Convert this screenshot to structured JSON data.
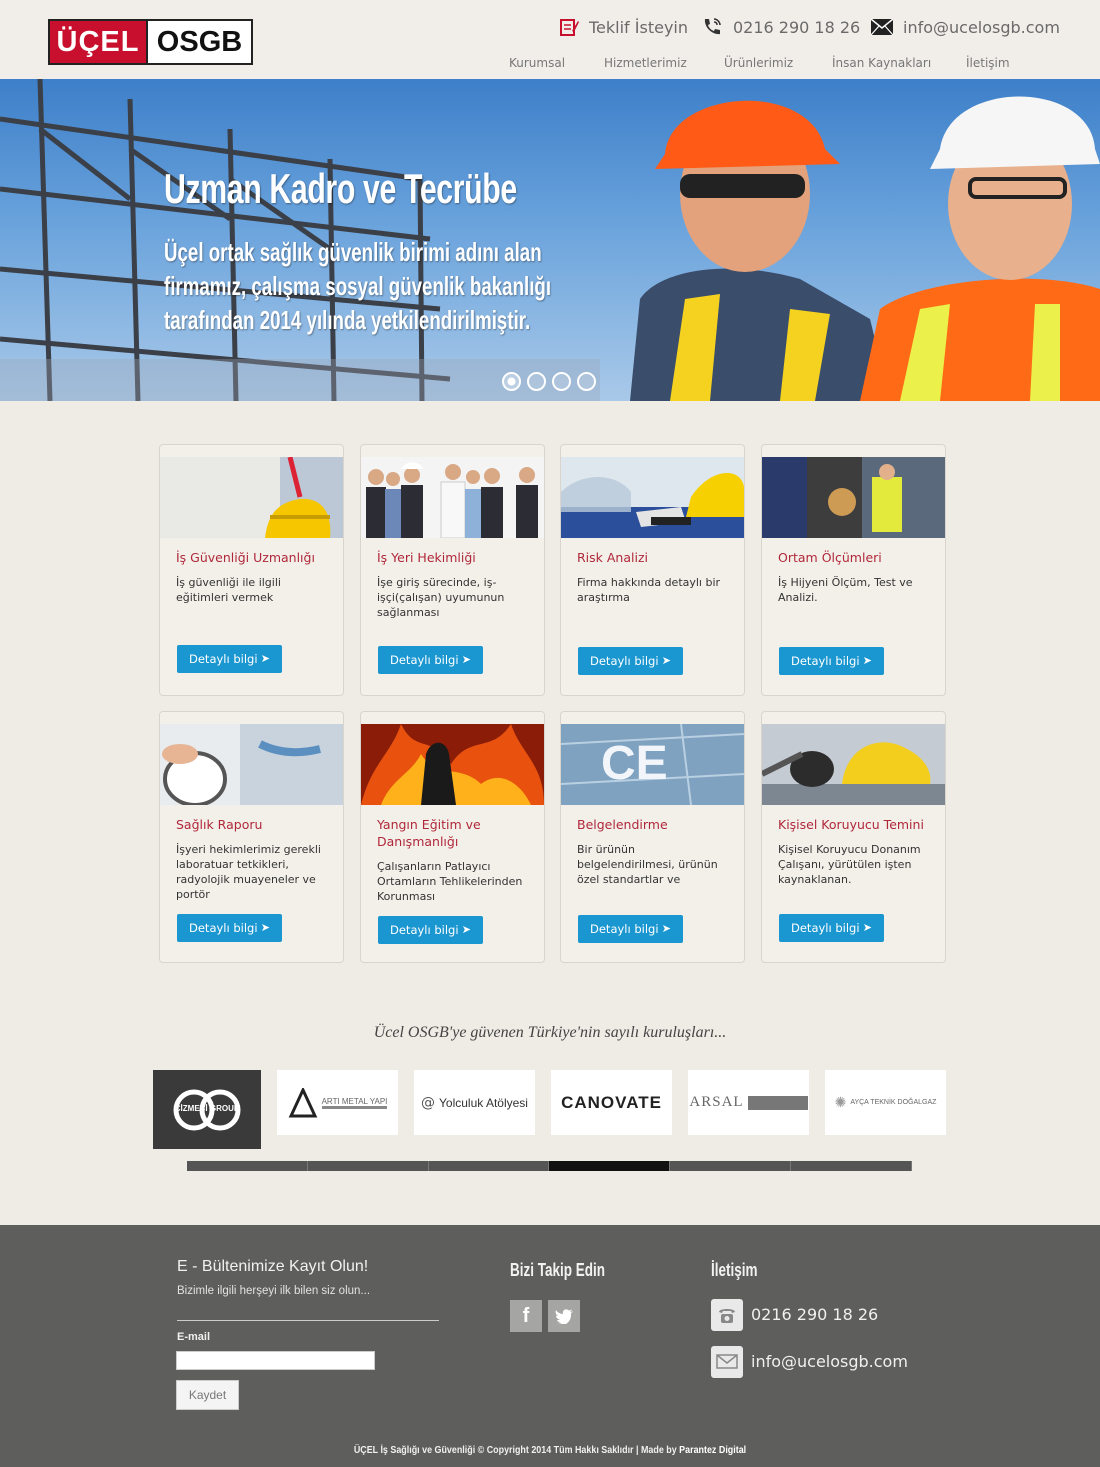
{
  "logo": {
    "part1": "ÜÇEL",
    "part2": "OSGB"
  },
  "header": {
    "quote": "Teklif İsteyin",
    "phone": "0216 290 18 26",
    "email": "info@ucelosgb.com"
  },
  "nav": [
    "Kurumsal",
    "Hizmetlerimiz",
    "Ürünlerimiz",
    "İnsan Kaynakları",
    "İletişim"
  ],
  "hero": {
    "title": "Uzman Kadro ve Tecrübe",
    "text": "Üçel ortak sağlık güvenlik birimi adını alan firmamız, çalışma sosyal güvenlik bakanlığı tarafından 2014 yılında yetkilendirilmiştir.",
    "slides": 4,
    "active_slide": 1
  },
  "services": [
    {
      "title": "İş Güvenliği Uzmanlığı",
      "desc": "İş güvenliği ile ilgili eğitimleri vermek",
      "button": "Detaylı bilgi"
    },
    {
      "title": "İş Yeri Hekimliği",
      "desc": "İşe giriş sürecinde, iş-işçi(çalışan) uyumunun sağlanması",
      "button": "Detaylı bilgi"
    },
    {
      "title": "Risk Analizi",
      "desc": "Firma hakkında detaylı bir araştırma",
      "button": "Detaylı bilgi"
    },
    {
      "title": "Ortam Ölçümleri",
      "desc": "İş Hijyeni Ölçüm, Test ve Analizi.",
      "button": "Detaylı bilgi"
    },
    {
      "title": "Sağlık Raporu",
      "desc": "İşyeri hekimlerimiz gerekli laboratuar tetkikleri, radyolojik muayeneler ve portör",
      "button": "Detaylı bilgi"
    },
    {
      "title": "Yangın Eğitim ve Danışmanlığı",
      "desc": "Çalışanların Patlayıcı Ortamların Tehlikelerinden Korunması",
      "button": "Detaylı bilgi"
    },
    {
      "title": "Belgelendirme",
      "desc": "Bir ürünün belgelendirilmesi, ürünün özel standartlar ve",
      "button": "Detaylı bilgi"
    },
    {
      "title": "Kişisel Koruyucu Temini",
      "desc": "Kişisel Koruyucu Donanım Çalışanı, yürütülen işten kaynaklanan.",
      "button": "Detaylı bilgi"
    }
  ],
  "partners": {
    "heading": "Ücel OSGB'ye güvenen Türkiye'nin sayılı kuruluşları...",
    "logos": [
      "ÇİZMECİ GROUP",
      "ARTI METAL YAPI",
      "Yolculuk Atölyesi",
      "CANOVATE",
      "ARSAL",
      "AYÇA TEKNİK DOĞALGAZ"
    ],
    "scroll_active": 4,
    "scroll_segments": 6
  },
  "footer": {
    "newsletter_title": "E - Bültenimize Kayıt Olun!",
    "newsletter_sub": "Bizimle ilgili herşeyi ilk bilen siz olun...",
    "email_label": "E-mail",
    "submit": "Kaydet",
    "follow": "Bizi Takip Edin",
    "contact_title": "İletişim",
    "phone": "0216 290 18 26",
    "email": "info@ucelosgb.com",
    "copyright": "ÜÇEL İş Sağlığı ve Güvenliği © Copyright 2014 Tüm Hakkı Saklıdır  |  Made by",
    "maker": "Parantez Digital"
  }
}
